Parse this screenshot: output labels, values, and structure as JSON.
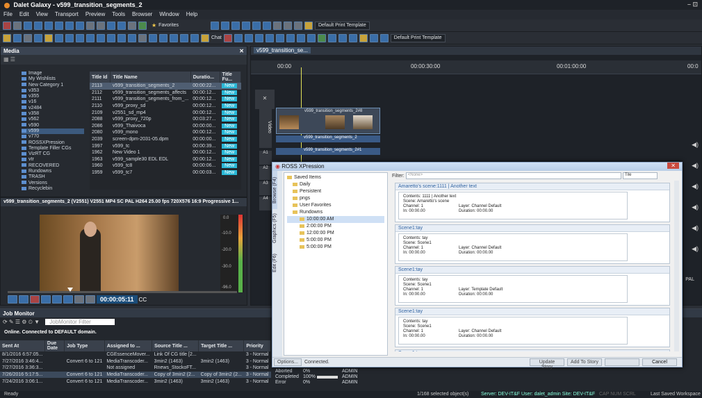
{
  "window": {
    "title": "Dalet Galaxy - v599_transition_segments_2"
  },
  "menu": [
    "File",
    "Edit",
    "View",
    "Transport",
    "Preview",
    "Tools",
    "Browser",
    "Window",
    "Help"
  ],
  "toolbar1": {
    "favorites_label": "Favorites",
    "template_select": "Default Print Template"
  },
  "toolbar2": {
    "chat_label": "Chat",
    "template_select": "Default Print Template"
  },
  "media_panel": {
    "title": "Media",
    "tree": [
      "Image",
      "My Wishlists",
      "New Category 1",
      "v353",
      "v355",
      "v16",
      "v2484",
      "v358",
      "v562",
      "v590",
      "v599",
      "v770",
      "ROSSXPression",
      "Template Filler CGs",
      "VizRT CG",
      "vtr",
      "RECOVERED",
      "Rundowns",
      "TRASH",
      "Versions",
      "Recyclebin"
    ],
    "columns": [
      "Title Id",
      "Title Name",
      "Duratio...",
      "Title Fu..."
    ],
    "rows": [
      {
        "id": "2113",
        "name": "v599_transition_segments_2",
        "dur": "00:00:22...",
        "status": "New"
      },
      {
        "id": "2112",
        "name": "v599_transition_segments_affects",
        "dur": "00:00:12...",
        "status": "New"
      },
      {
        "id": "2111",
        "name": "v599_transition_segments_from_...",
        "dur": "00:00:12...",
        "status": "New"
      },
      {
        "id": "2110",
        "name": "v599_proxy_sd",
        "dur": "00:00:12...",
        "status": "New"
      },
      {
        "id": "2109",
        "name": "v2551_sd_mp4",
        "dur": "00:00:12...",
        "status": "New"
      },
      {
        "id": "2088",
        "name": "v599_proxy_720p",
        "dur": "00:03:27...",
        "status": "New"
      },
      {
        "id": "2086",
        "name": "v599_Thaivoca",
        "dur": "00:00:00...",
        "status": "New"
      },
      {
        "id": "2080",
        "name": "v599_mono",
        "dur": "00:00:12...",
        "status": "New"
      },
      {
        "id": "2039",
        "name": "screen-dpm-2031-05.dpm",
        "dur": "00:00:00...",
        "status": "New"
      },
      {
        "id": "1997",
        "name": "v599_tc",
        "dur": "00:00:39...",
        "status": "New"
      },
      {
        "id": "1962",
        "name": "New Video 1",
        "dur": "00:00:12...",
        "status": "New"
      },
      {
        "id": "1963",
        "name": "v599_sample30 EDL EDL",
        "dur": "00:00:12...",
        "status": "New"
      },
      {
        "id": "1960",
        "name": "v599_tc8",
        "dur": "00:00:06...",
        "status": "New"
      },
      {
        "id": "1959",
        "name": "v599_tc7",
        "dur": "00:00:03...",
        "status": "New"
      }
    ]
  },
  "preview": {
    "title": "v599_transition_segments_2 (V2551) V2551 MP4 SC PAL H264 25.00 fps 720X576 16:9 Progressive 1...",
    "timecode": "00:00:05:11",
    "cc_label": "CC",
    "meter_labels": [
      "0.0",
      "-10.0",
      "-20.0",
      "-30.0",
      "-96.0"
    ]
  },
  "timeline": {
    "tab": "v599_transition_se...",
    "ruler": [
      "00:00",
      "00:00:30:00",
      "00:01:00:00",
      "00:0"
    ],
    "tracks": [
      "Video",
      "A1",
      "A2",
      "A3",
      "A4"
    ],
    "clip_labels": [
      "v599_transition_segments_2#8",
      "v599_transition_segments_2",
      "v599_transition_segments_2#1"
    ],
    "pal_label": "PAL"
  },
  "job_monitor": {
    "title": "Job Monitor",
    "filter_placeholder": "JobMonitor Filter",
    "status": "Online. Connected to DEFAULT domain.",
    "columns": [
      "Sent At",
      "Due Date",
      "Job Type",
      "Assigned to ...",
      "Source Title ...",
      "Target Title ...",
      "Priority"
    ],
    "rows": [
      {
        "sent": "8/1/2016 6:57:05...",
        "due": "",
        "type": "",
        "assigned": "CGEssenceMover...",
        "src": "Link Of CG title [2...",
        "tgt": "",
        "prio": "3 - Normal",
        "state": "",
        "pct": "",
        "user": ""
      },
      {
        "sent": "7/27/2016 3:46:4...",
        "due": "",
        "type": "Convert 6 to 121",
        "assigned": "MediaTranscoder...",
        "src": "3min2 (1463)",
        "tgt": "3min2 (1463)",
        "prio": "3 - Normal",
        "state": "Completed",
        "pct": "100%",
        "user": "ADMIN"
      },
      {
        "sent": "7/27/2016 3:36:3...",
        "due": "",
        "type": "",
        "assigned": "Not assigned",
        "src": "Rnews_StockoFT...",
        "tgt": "",
        "prio": "3 - Normal",
        "state": "Aborted",
        "pct": "0%",
        "user": "ADMIN"
      },
      {
        "sent": "7/26/2016 5:17:5...",
        "due": "",
        "type": "Convert 6 to 121",
        "assigned": "MediaTranscoder...",
        "src": "Copy of 3min2 (2...",
        "tgt": "Copy of 3min2 (2...",
        "prio": "3 - Normal",
        "state": "Completed",
        "pct": "100%",
        "user": "ADMIN"
      },
      {
        "sent": "7/24/2016 3:06:1...",
        "due": "",
        "type": "Convert 6 to 121",
        "assigned": "MediaTranscoder...",
        "src": "3min2 (1463)",
        "tgt": "3min2 (1463)",
        "prio": "3 - Normal",
        "state": "Error",
        "pct": "0%",
        "user": "ADMIN"
      }
    ]
  },
  "xpression": {
    "title": "ROSS XPression",
    "side_tabs": [
      "Browse (F4)",
      "Graphics (F5)",
      "Edit (F6)"
    ],
    "tree": [
      "Saved Items",
      "Daily",
      "Persistent",
      "pngs",
      "User Favorites",
      "Rundowns",
      "10:00:00 AM",
      "2:00:00 PM",
      "12:00:00 PM",
      "5:00:00 PM",
      "5:00:00 PM"
    ],
    "filter_label": "Filter:",
    "filter_placeholder": "<None>",
    "type_select": "Tile",
    "cards": [
      {
        "head": "Amaretto's scene:1111 | Another text",
        "lines": [
          "Contents: 1111 | Another text",
          "Scene: Amaretto's scene",
          "Channel: 1",
          "In: 00:00.00"
        ],
        "lines2": [
          "",
          "",
          "Layer: Channel Default",
          "Duration: 00:00.00"
        ]
      },
      {
        "head": "Scene1:tay",
        "lines": [
          "Contents: tay",
          "Scene: Scene1",
          "Channel: 1",
          "In: 00:00.00"
        ],
        "lines2": [
          "",
          "",
          "Layer: Channel Default",
          "Duration: 00:00.00"
        ]
      },
      {
        "head": "Scene1:tay",
        "lines": [
          "Contents: tay",
          "Scene: Scene1",
          "Channel: 1",
          "In: 00:00.00"
        ],
        "lines2": [
          "",
          "",
          "Layer: Template Default",
          "Duration: 00:00.00"
        ]
      },
      {
        "head": "Scene1:tay",
        "lines": [
          "Contents: tay",
          "Scene: Scene1",
          "Channel: 1",
          "In: 00:00.00"
        ],
        "lines2": [
          "",
          "",
          "Layer: Channel Default",
          "Duration: 00:00.00"
        ]
      },
      {
        "head": "Scene1:tay",
        "lines": [],
        "lines2": []
      }
    ],
    "options_label": "Options...",
    "connected_label": "Connected.",
    "buttons": [
      "Update Story",
      "Add To Story",
      "",
      "Cancel"
    ]
  },
  "statusbar": {
    "ready": "Ready",
    "selected": "1/168 selected object(s)",
    "server": "Server: DEV-IT&F User: dalet_admin Site: DEV-IT&F",
    "caps": "CAP NUM SCRL",
    "workspace": "Last Saved Workspace"
  }
}
